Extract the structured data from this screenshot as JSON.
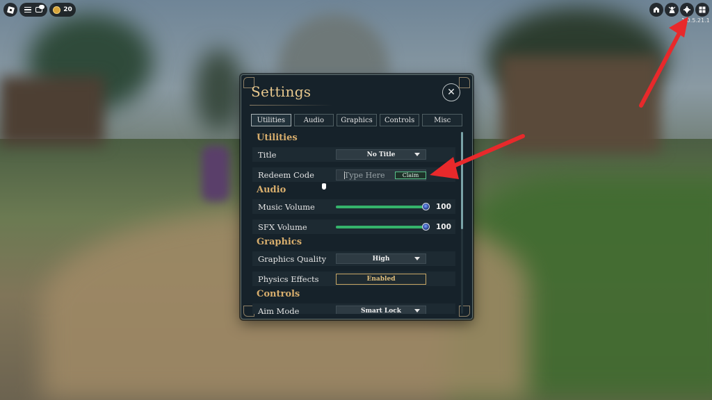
{
  "hud": {
    "coins": "20",
    "version": "1.0.5.21.1",
    "icons": [
      "roblox-logo-icon",
      "menu-icon",
      "chat-icon",
      "coin-icon",
      "shop-icon",
      "character-icon",
      "gear-icon",
      "grid-icon"
    ]
  },
  "settings": {
    "title": "Settings",
    "close_glyph": "✕",
    "tabs": [
      {
        "label": "Utilities",
        "active": true
      },
      {
        "label": "Audio",
        "active": false
      },
      {
        "label": "Graphics",
        "active": false
      },
      {
        "label": "Controls",
        "active": false
      },
      {
        "label": "Misc",
        "active": false
      }
    ],
    "sections": {
      "utilities": {
        "heading": "Utilities",
        "title_label": "Title",
        "title_value": "No Title",
        "redeem_label": "Redeem Code",
        "redeem_placeholder": "Type Here",
        "claim_label": "Claim"
      },
      "audio": {
        "heading": "Audio",
        "music_label": "Music Volume",
        "music_value": "100",
        "music_level": 1.0,
        "sfx_label": "SFX Volume",
        "sfx_value": "100",
        "sfx_level": 1.0
      },
      "graphics": {
        "heading": "Graphics",
        "quality_label": "Graphics Quality",
        "quality_value": "High",
        "physics_label": "Physics Effects",
        "physics_value": "Enabled"
      },
      "controls": {
        "heading": "Controls",
        "aim_label": "Aim Mode",
        "aim_value": "Smart Lock"
      }
    }
  },
  "colors": {
    "accent_gold": "#d8ae6d",
    "slider_green": "#35b36b",
    "claim_green": "#57c38a",
    "arrow_red": "#e8292b",
    "panel_bg": "#16222a"
  }
}
